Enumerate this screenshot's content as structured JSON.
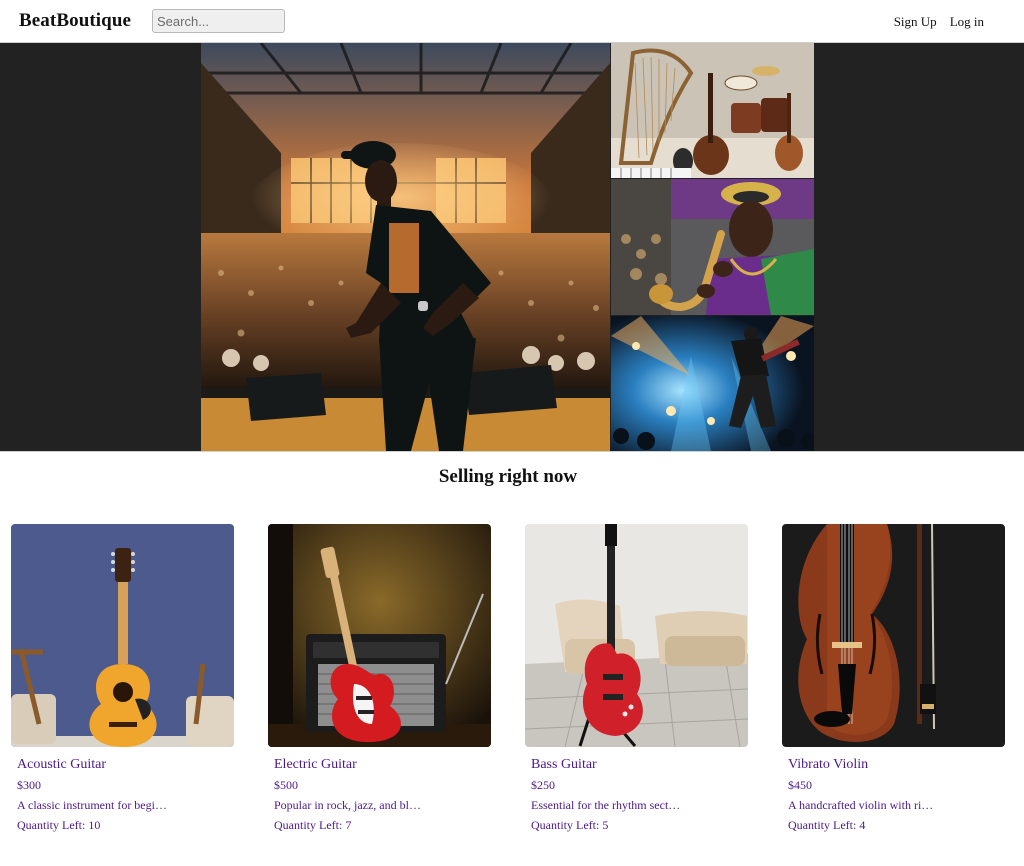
{
  "header": {
    "brand": "BeatBoutique",
    "search_placeholder": "Search...",
    "signup_label": "Sign Up",
    "login_label": "Log in"
  },
  "hero": {
    "images": [
      "concert-performer-image",
      "instruments-collection-image",
      "saxophone-player-image",
      "rock-concert-image"
    ]
  },
  "section": {
    "title": "Selling right now"
  },
  "products": [
    {
      "name": "Acoustic Guitar",
      "price": "$300",
      "description": "A classic instrument for begi…",
      "quantity": "Quantity Left: 10"
    },
    {
      "name": "Electric Guitar",
      "price": "$500",
      "description": "Popular in rock, jazz, and bl…",
      "quantity": "Quantity Left: 7"
    },
    {
      "name": "Bass Guitar",
      "price": "$250",
      "description": "Essential for the rhythm sect…",
      "quantity": "Quantity Left: 5"
    },
    {
      "name": "Vibrato Violin",
      "price": "$450",
      "description": "A handcrafted violin with ri…",
      "quantity": "Quantity Left: 4"
    }
  ],
  "colors": {
    "hero_background": "#222222",
    "product_text": "#4b1a8a",
    "header_background": "#ffffff"
  }
}
